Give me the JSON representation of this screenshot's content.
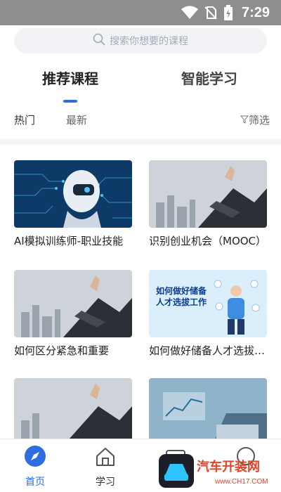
{
  "status_bar": {
    "time": "7:29",
    "icons": [
      "wifi-icon",
      "no-sim-icon",
      "battery-charging-icon"
    ]
  },
  "search": {
    "placeholder": "搜索你想要的课程",
    "icon": "search-icon"
  },
  "tabs": [
    {
      "label": "推荐课程",
      "active": true
    },
    {
      "label": "智能学习",
      "active": false
    }
  ],
  "filters": {
    "hot": "热门",
    "new": "最新",
    "screen": "筛选",
    "screen_icon": "filter-funnel-icon"
  },
  "courses": [
    {
      "title": "AI模拟训练师-职业技能",
      "thumb": "robot-ai-thumbnail"
    },
    {
      "title": "识别创业机会（MOOC）",
      "thumb": "business-growth-thumbnail"
    },
    {
      "title": "如何区分紧急和重要",
      "thumb": "business-growth-thumbnail"
    },
    {
      "title": "如何做好储备人才选拔工作",
      "thumb": "talent-selection-thumbnail",
      "thumb_text": [
        "如何做好储备",
        "人才选拔工作"
      ]
    },
    {
      "title": "",
      "thumb": "business-growth-thumbnail"
    },
    {
      "title": "",
      "thumb": "data-chart-thumbnail"
    }
  ],
  "bottom_nav": [
    {
      "label": "首页",
      "icon": "compass-icon",
      "active": true
    },
    {
      "label": "学习",
      "icon": "home-icon",
      "active": false
    },
    {
      "label": "",
      "icon": "tv-icon",
      "active": false
    },
    {
      "label": "",
      "icon": "profile-icon",
      "active": false
    }
  ],
  "watermark": {
    "text": "汽车开装网",
    "url": "www.CH17.COM"
  },
  "colors": {
    "accent": "#2f6de0",
    "status_bar": "#8e8e8e",
    "search_bg": "#f1f3f7"
  }
}
